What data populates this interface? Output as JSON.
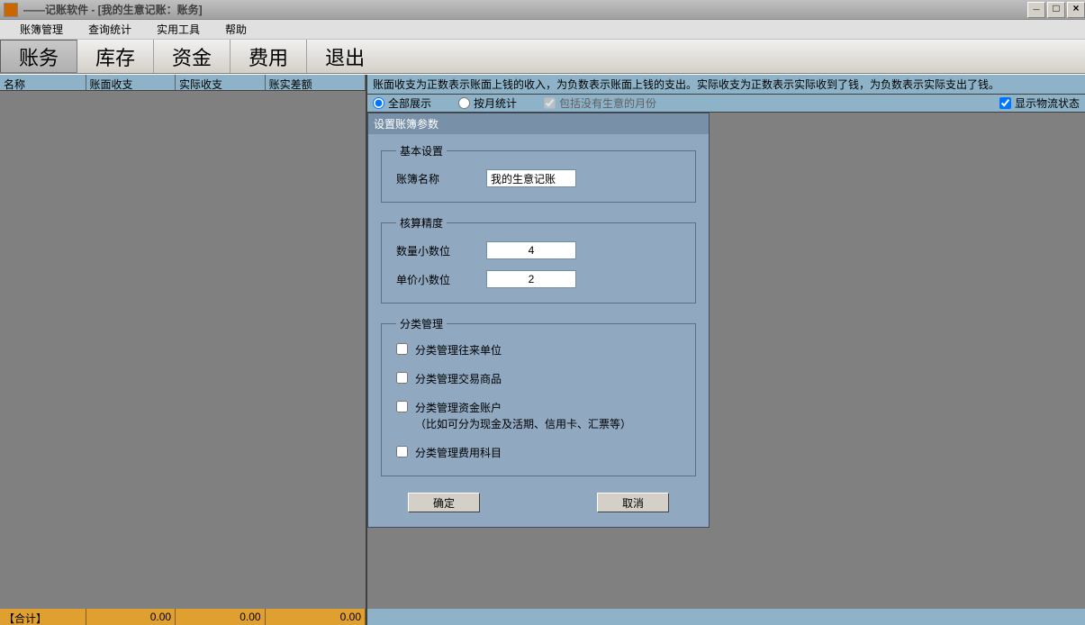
{
  "window": {
    "title": "——记账软件 - [我的生意记账：账务]"
  },
  "menubar": {
    "items": [
      "账簿管理",
      "查询统计",
      "实用工具",
      "帮助"
    ]
  },
  "toolbar": {
    "items": [
      "账务",
      "库存",
      "资金",
      "费用",
      "退出"
    ],
    "active_index": 0
  },
  "left_table": {
    "headers": [
      "名称",
      "账面收支",
      "实际收支",
      "账实差额"
    ],
    "widths": [
      96,
      100,
      100,
      112
    ],
    "footer": [
      "【合计】",
      "0.00",
      "0.00",
      "0.00"
    ]
  },
  "right": {
    "hint": "账面收支为正数表示账面上钱的收入，为负数表示账面上钱的支出。实际收支为正数表示实际收到了钱，为负数表示实际支出了钱。",
    "filters": {
      "opt_all": "全部展示",
      "opt_monthly": "按月统计",
      "include_empty": "包括没有生意的月份",
      "show_logistics": "显示物流状态",
      "selected": "all",
      "include_empty_checked": true,
      "show_logistics_checked": true
    }
  },
  "dialog": {
    "title": "设置账簿参数",
    "basic": {
      "legend": "基本设置",
      "name_label": "账簿名称",
      "name_value": "我的生意记账"
    },
    "precision": {
      "legend": "核算精度",
      "qty_label": "数量小数位",
      "qty_value": "4",
      "price_label": "单价小数位",
      "price_value": "2"
    },
    "categories": {
      "legend": "分类管理",
      "opt_partner": "分类管理往来单位",
      "opt_goods": "分类管理交易商品",
      "opt_funds": "分类管理资金账户",
      "opt_funds_sub": "（比如可分为现金及活期、信用卡、汇票等）",
      "opt_expense": "分类管理费用科目"
    },
    "ok": "确定",
    "cancel": "取消"
  }
}
